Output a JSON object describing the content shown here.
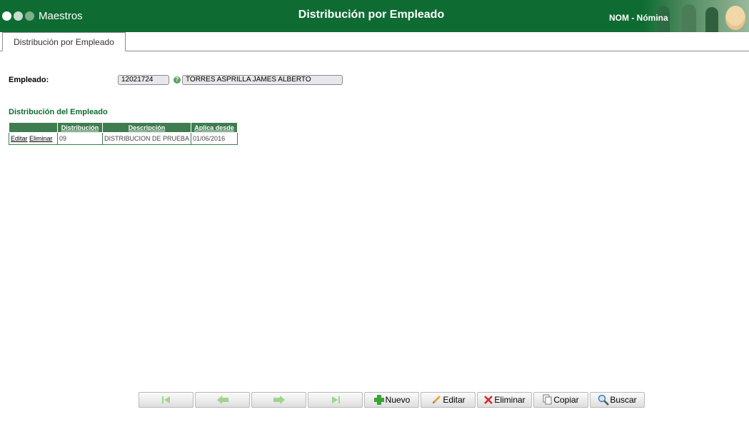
{
  "header": {
    "module": "Maestros",
    "title": "Distribución por Empleado",
    "app_label": "NOM - Nómina"
  },
  "tabs": [
    {
      "label": "Distribución por Empleado",
      "active": true
    }
  ],
  "form": {
    "empleado_label": "Empleado:",
    "empleado_code": "12021724",
    "empleado_name": "TORRES ASPRILLA JAMES ALBERTO"
  },
  "section_title": "Distribución del Empleado",
  "grid": {
    "columns": [
      "",
      "Distribución",
      "Descripción",
      "Aplica desde"
    ],
    "rows": [
      {
        "edit": "Editar",
        "delete": "Eliminar",
        "distribucion": "09",
        "descripcion": "DISTRIBUCION DE PRUEBA",
        "aplica_desde": "01/06/2016"
      }
    ]
  },
  "toolbar": {
    "nuevo": "Nuevo",
    "editar": "Editar",
    "eliminar": "Eliminar",
    "copiar": "Copiar",
    "buscar": "Buscar"
  },
  "colors": {
    "brand_green": "#0e6b32",
    "grid_header": "#3f7d51",
    "nav_disabled": "#9fd58a"
  }
}
